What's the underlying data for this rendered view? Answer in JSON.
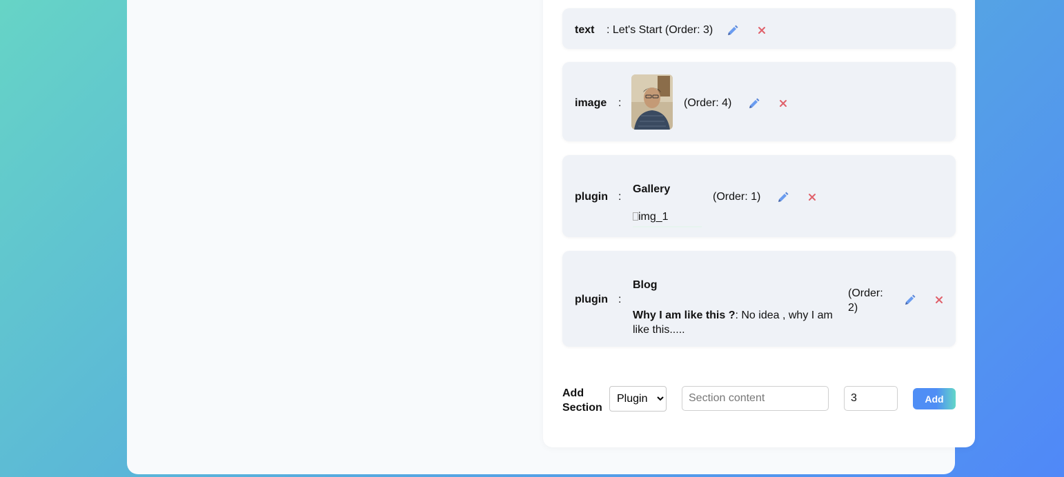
{
  "sections": [
    {
      "type": "text",
      "content": ": Let's Start (Order: 3)"
    },
    {
      "type": "image",
      "colon": ":",
      "order": "(Order: 4)"
    },
    {
      "type": "plugin",
      "colon": ":",
      "plugin_name": "Gallery",
      "image_alt": "img_1",
      "order": "(Order: 1)"
    },
    {
      "type": "plugin",
      "colon": ":",
      "plugin_name": "Blog",
      "post_title": "Why I am like this ?",
      "post_body": ": No idea , why I am like this.....",
      "order_line1": "(Order:",
      "order_line2": "2)"
    }
  ],
  "add_section": {
    "label_line1": "Add",
    "label_line2": "Section",
    "type_options": [
      "Plugin"
    ],
    "type_selected": "Plugin",
    "content_placeholder": "Section content",
    "content_value": "",
    "order_value": "3",
    "add_label": "Add"
  },
  "icons": {
    "edit": "pencil-icon",
    "delete": "close-icon"
  },
  "colors": {
    "edit": "#6a9cf0",
    "delete": "#e0606a",
    "accent": "#4f8ef5"
  }
}
